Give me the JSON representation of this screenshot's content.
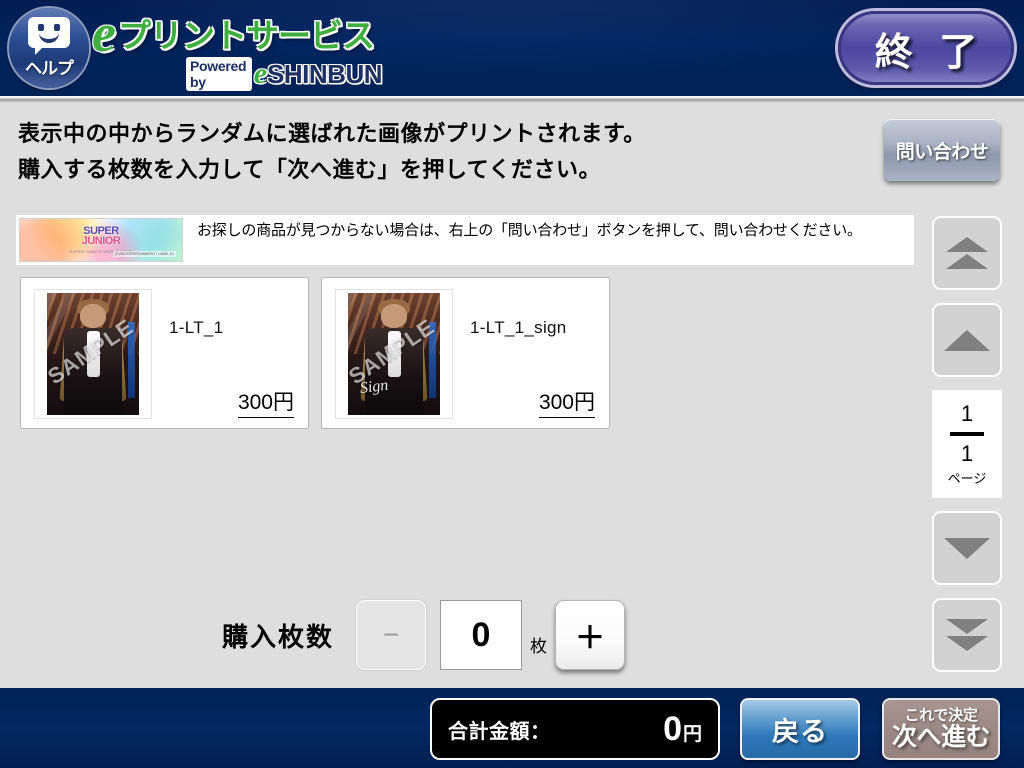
{
  "header": {
    "help_label": "ヘルプ",
    "help_icon": "speech-bubble-smiley-icon",
    "brand_e": "e",
    "brand_service": "プリントサービス",
    "brand_powered": "Powered by",
    "brand_e2": "e",
    "brand_shinbun": "SHINBUN",
    "exit_label": "終 了"
  },
  "instructions": {
    "line1": "表示中の中からランダムに選ばれた画像がプリントされます。",
    "line2": "購入する枚数を入力して「次へ進む」を押してください。",
    "inquiry_label": "問い合わせ"
  },
  "notice": {
    "text": "お探しの商品が見つからない場合は、右上の「問い合わせ」ボタンを押して、問い合わせください。",
    "thumbnail": {
      "title_top": "SUPER",
      "title_bottom": "JUNIOR",
      "subtitle": "SUPER JUNIOR WORLD TOUR",
      "caption": "(C)SM ENTERTAINMENT / LABEL SJ"
    }
  },
  "products": [
    {
      "name": "1-LT_1",
      "price": "300円",
      "watermark": "SAMPLE",
      "has_signature": false,
      "signature": ""
    },
    {
      "name": "1-LT_1_sign",
      "price": "300円",
      "watermark": "SAMPLE",
      "has_signature": true,
      "signature": "Sign"
    }
  ],
  "pager": {
    "first_icon": "double-chevron-up-icon",
    "prev_icon": "chevron-up-icon",
    "current_page": "1",
    "total_pages": "1",
    "page_unit": "ページ",
    "next_icon": "chevron-down-icon",
    "last_icon": "double-chevron-down-icon"
  },
  "quantity": {
    "label": "購入枚数",
    "minus_label": "−",
    "value": "0",
    "unit": "枚",
    "plus_label": "＋"
  },
  "footer": {
    "total_label": "合計金額：",
    "total_amount": "0",
    "total_currency": "円",
    "back_label": "戻る",
    "next_small_label": "これで決定",
    "next_large_label": "次へ進む"
  },
  "colors": {
    "header_navy": "#02235c",
    "body_gray": "#dedede",
    "accent_green": "#3eae3f",
    "exit_purple": "#4c47a0",
    "back_blue": "#2f78bb",
    "next_disabled": "#9e8b86"
  }
}
